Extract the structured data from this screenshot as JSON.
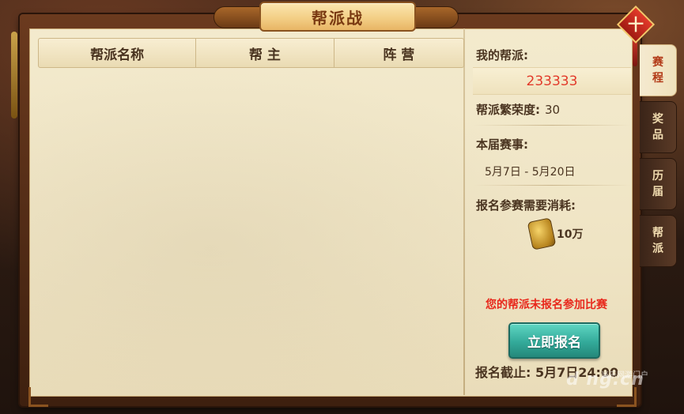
{
  "window": {
    "title": "帮派战"
  },
  "table": {
    "headers": [
      "帮派名称",
      "帮 主",
      "阵 营"
    ]
  },
  "info": {
    "my_guild_label": "我的帮派:",
    "my_guild_value": "233333",
    "prosperity_label": "帮派繁荣度:",
    "prosperity_value": "30",
    "season_label": "本届赛事:",
    "season_dates": "5月7日 - 5月20日",
    "cost_label": "报名参赛需要消耗:",
    "cost_value": "10万",
    "notice": "您的帮派未报名参加比赛",
    "signup_button": "立即报名",
    "deadline": "报名截止: 5月7日24:00"
  },
  "tabs": [
    {
      "label_top": "赛",
      "label_bottom": "程",
      "active": true
    },
    {
      "label_top": "奖",
      "label_bottom": "品",
      "active": false
    },
    {
      "label_top": "历",
      "label_bottom": "届",
      "active": false
    },
    {
      "label_top": "帮",
      "label_bottom": "派",
      "active": false
    }
  ],
  "close_icon": "close-icon",
  "watermark": {
    "small": "当乐网游门户",
    "big": "d ng.cn"
  },
  "colors": {
    "accent_red": "#e23a2a",
    "button_teal": "#33aa9a",
    "paper": "#efe4c4",
    "frame_brown": "#6b3a1e"
  }
}
